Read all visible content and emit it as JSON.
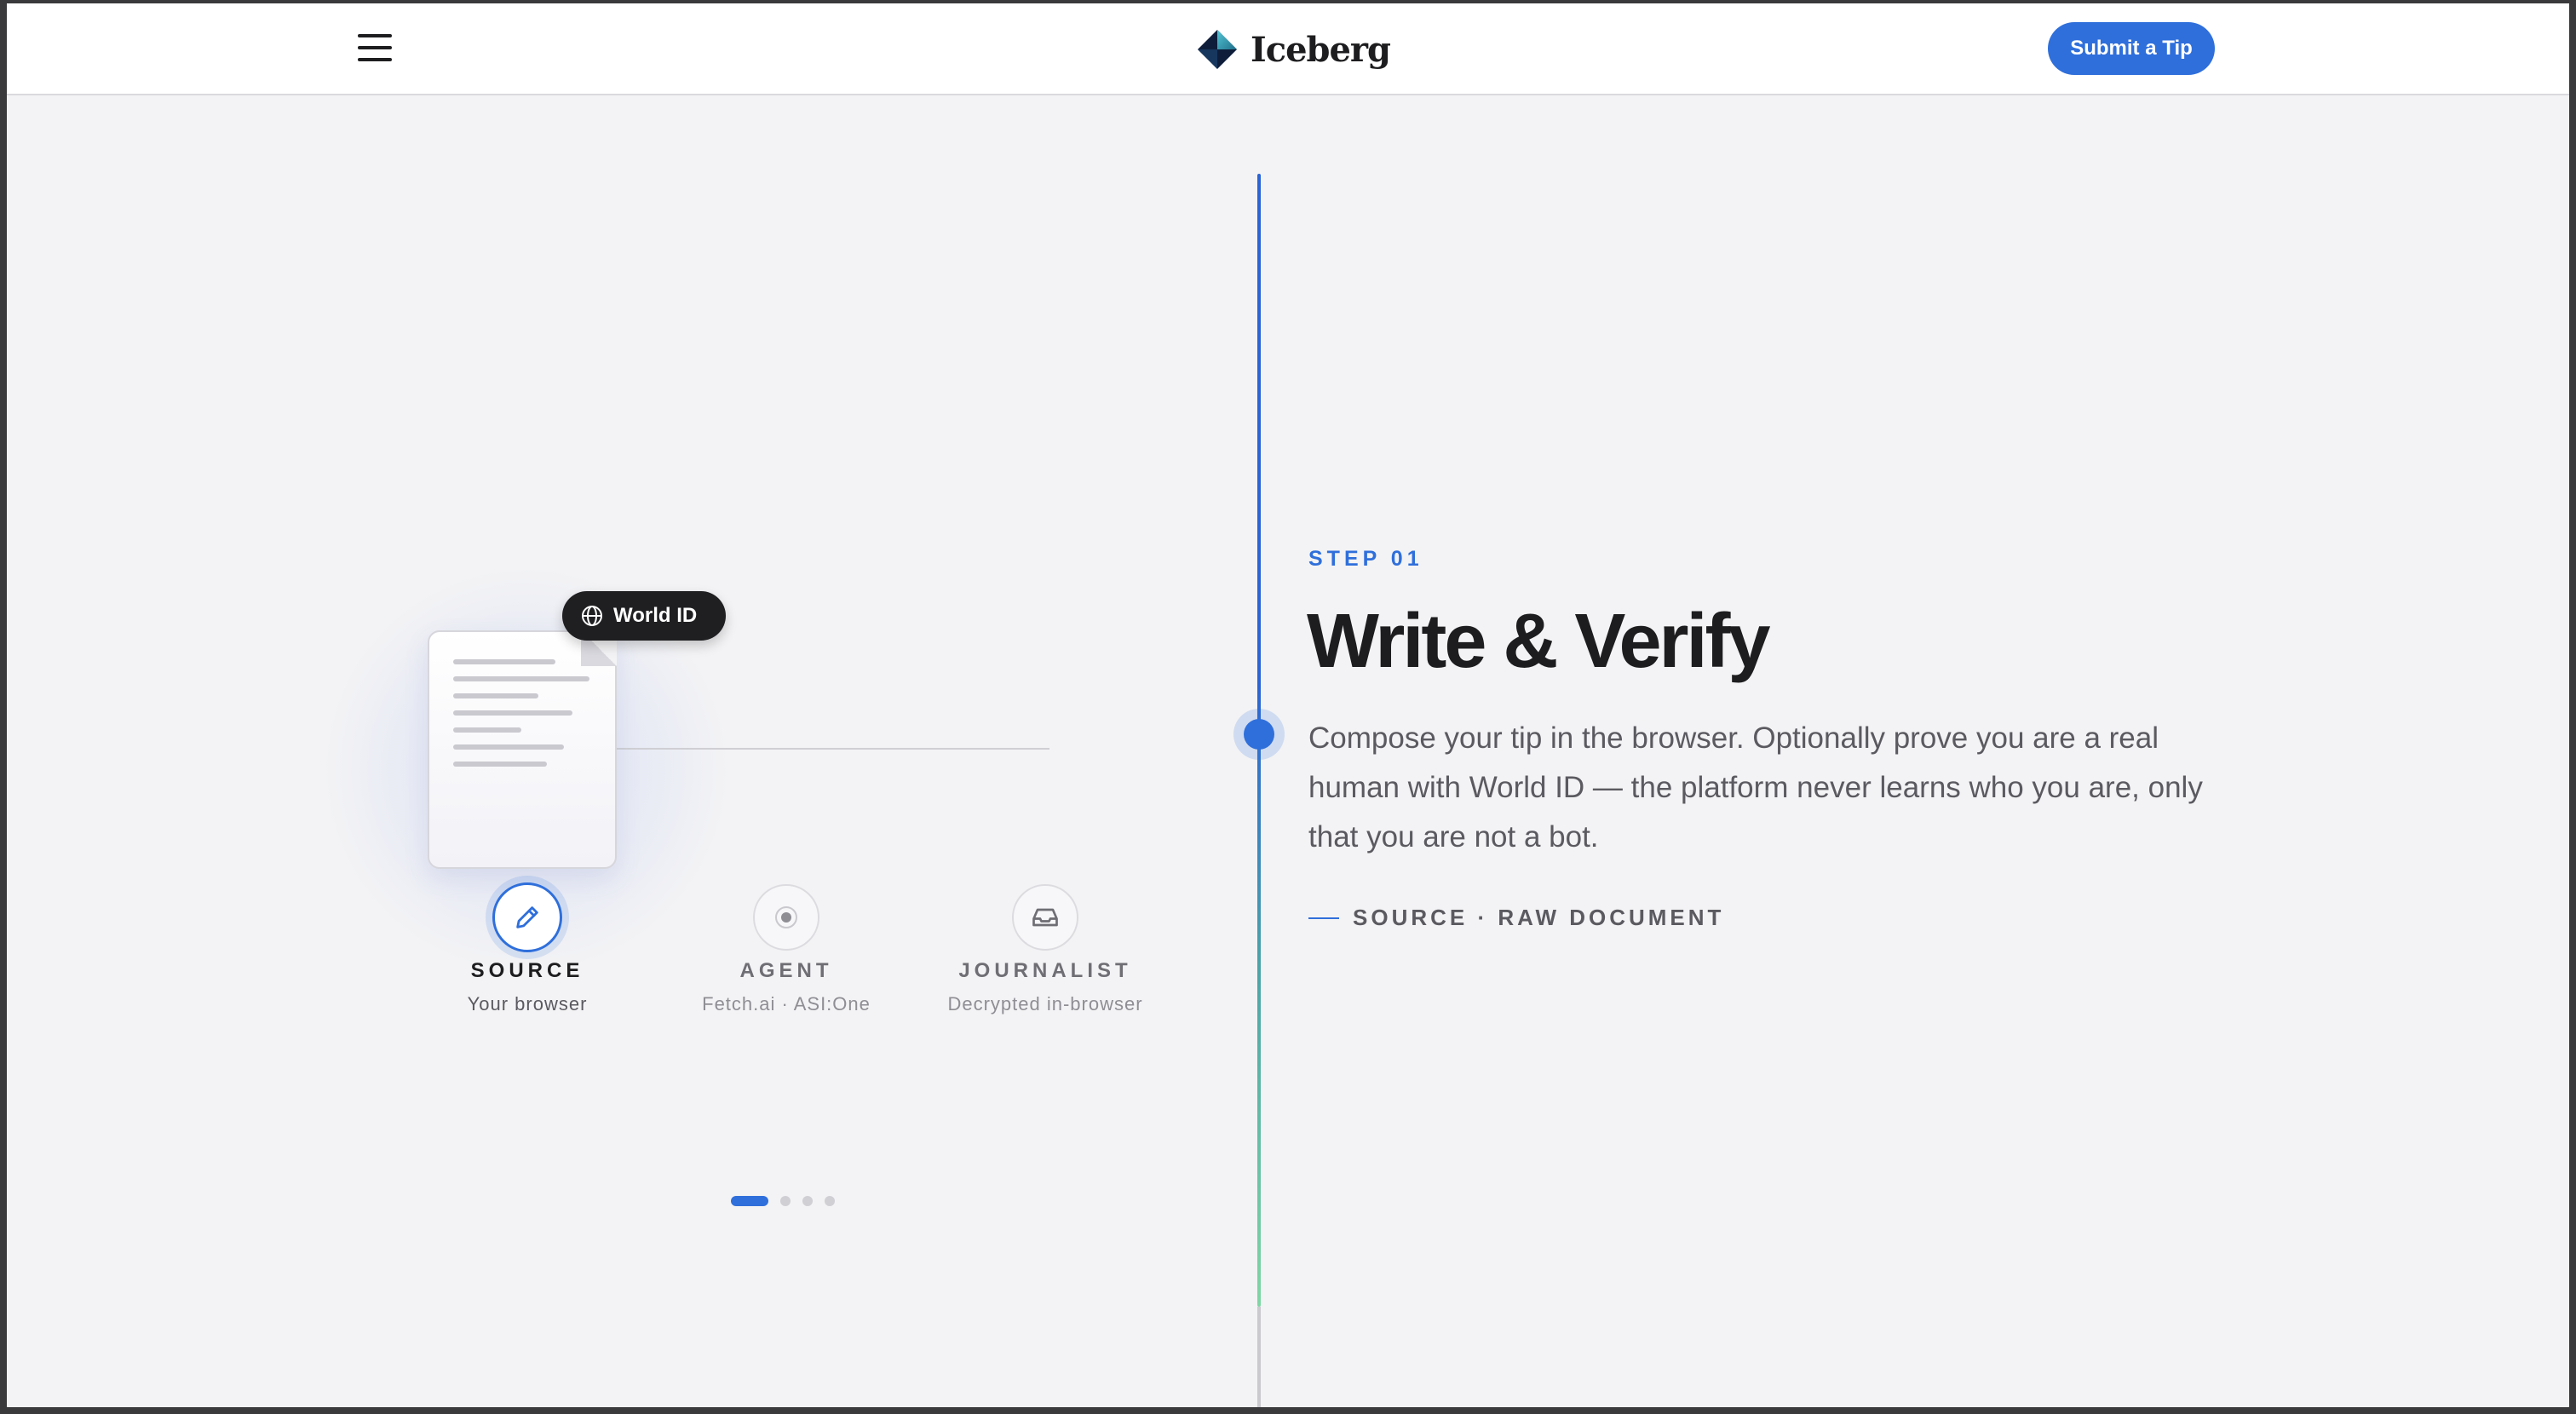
{
  "header": {
    "brand": "Iceberg",
    "cta_label": "Submit a Tip"
  },
  "step": {
    "label": "STEP 01",
    "title": "Write & Verify",
    "description": "Compose your tip in the browser. Optionally prove you are a real human with World ID — the platform never learns who you are, only that you are not a bot.",
    "tag": "SOURCE · RAW DOCUMENT"
  },
  "illustration": {
    "badge_label": "World ID",
    "nodes": [
      {
        "label": "SOURCE",
        "sub": "Your browser",
        "icon": "pencil-icon",
        "active": true
      },
      {
        "label": "AGENT",
        "sub": "Fetch.ai · ASI:One",
        "icon": "radar-icon",
        "active": false
      },
      {
        "label": "JOURNALIST",
        "sub": "Decrypted in-browser",
        "icon": "inbox-icon",
        "active": false
      }
    ]
  },
  "pager": {
    "current": 1,
    "total": 4
  },
  "colors": {
    "accent": "#2f6fdb",
    "text_dark": "#1d1d1f",
    "text_muted": "#5a5a60",
    "background": "#f3f3f5"
  }
}
